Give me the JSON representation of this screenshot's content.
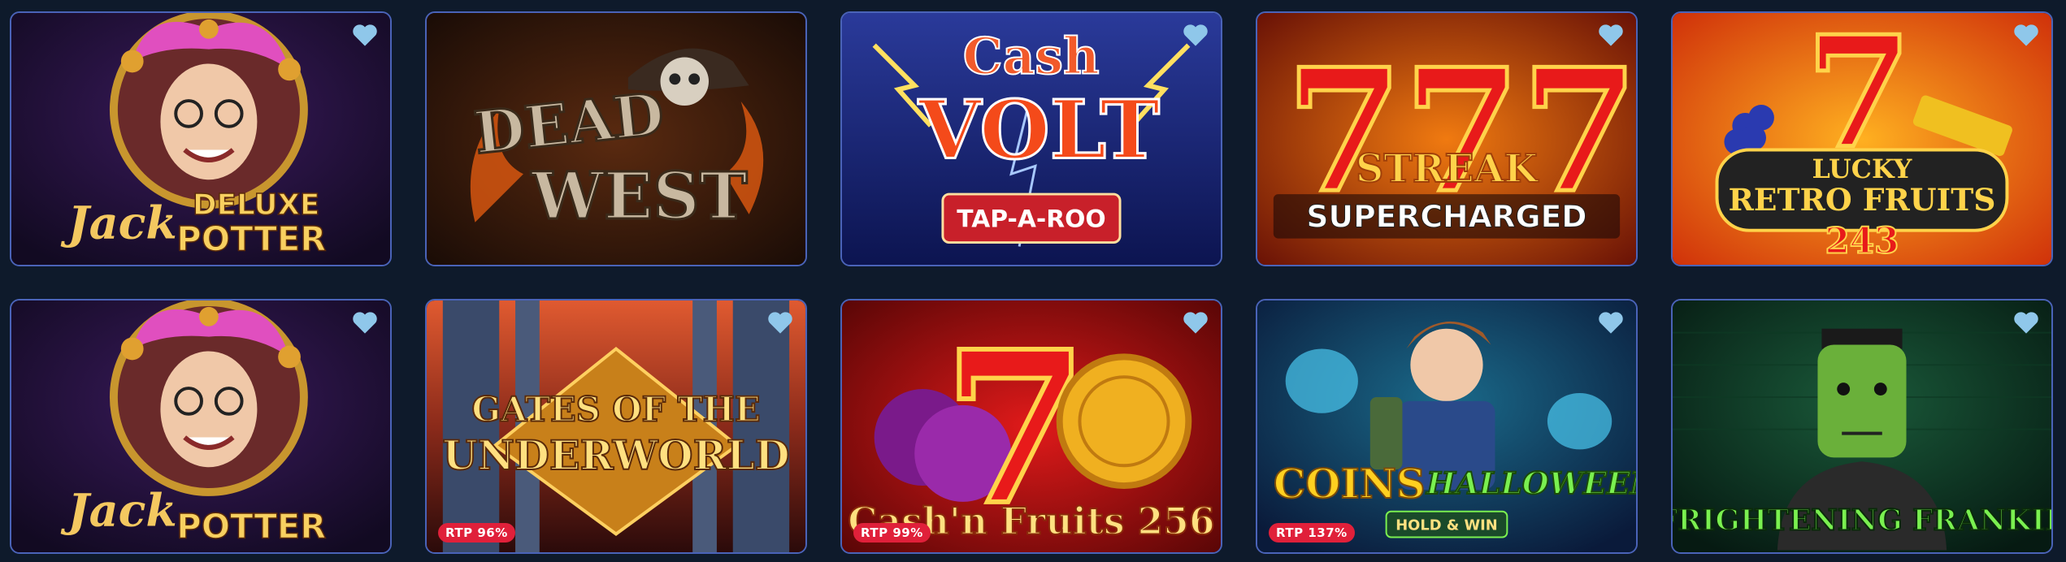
{
  "heart_color": "#8fc7ea",
  "games": [
    {
      "id": "jack-potter-deluxe",
      "logo_script": "Jack",
      "logo_top": "DELUXE",
      "logo_bottom": "POTTER",
      "rtp": ""
    },
    {
      "id": "dead-west",
      "logo_top": "DEAD",
      "logo_bottom": "WEST",
      "rtp": ""
    },
    {
      "id": "cash-volt",
      "logo_top": "Cash",
      "logo_mid": "VOLT",
      "logo_bottom": "TAP-A-ROO",
      "rtp": ""
    },
    {
      "id": "777-streak",
      "logo_top": "STREAK",
      "logo_bottom": "SUPERCHARGED",
      "rtp": ""
    },
    {
      "id": "lucky-retro-fruits",
      "logo_top": "LUCKY",
      "logo_mid": "RETRO FRUITS",
      "logo_bottom": "243",
      "rtp": ""
    },
    {
      "id": "jack-potter",
      "logo_script": "Jack",
      "logo_bottom": "POTTER",
      "rtp": ""
    },
    {
      "id": "gates-of-the-underworld",
      "logo_top": "GATES OF THE",
      "logo_bottom": "UNDERWORLD",
      "rtp": "RTP 96%"
    },
    {
      "id": "cash-n-fruits-256",
      "logo_bottom": "Cash'n Fruits 256",
      "rtp": "RTP 99%"
    },
    {
      "id": "coins-halloween",
      "logo_top": "COINS",
      "logo_mid": "HALLOWEEN",
      "logo_bottom": "HOLD & WIN",
      "rtp": "RTP 137%"
    },
    {
      "id": "frightening-frankie",
      "logo_bottom": "FRIGHTENING FRANKIE",
      "rtp": ""
    }
  ]
}
